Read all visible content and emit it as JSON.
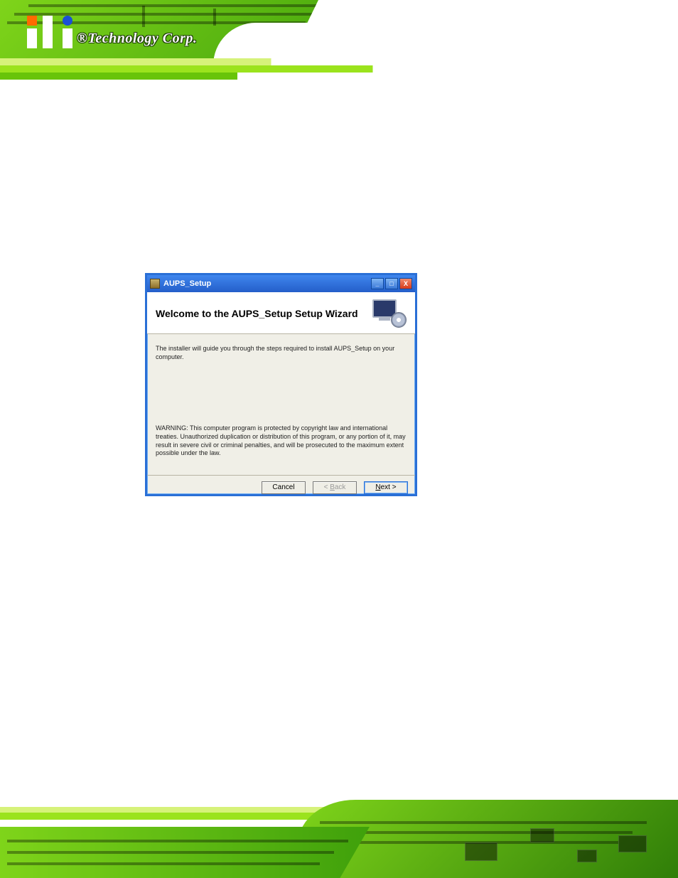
{
  "logo": {
    "brand_text": "®Technology Corp."
  },
  "dialog": {
    "title": "AUPS_Setup",
    "heading": "Welcome to the AUPS_Setup Setup Wizard",
    "intro": "The installer will guide you through the steps required to install AUPS_Setup on your computer.",
    "warning": "WARNING: This computer program is protected by copyright law and international treaties. Unauthorized duplication or distribution of this program, or any portion of it, may result in severe civil or criminal penalties, and will be prosecuted to the maximum extent possible under the law.",
    "buttons": {
      "cancel": "Cancel",
      "back_prefix": "< ",
      "back_u": "B",
      "back_rest": "ack",
      "next_u": "N",
      "next_rest": "ext >"
    },
    "window_controls": {
      "min": "_",
      "max": "□",
      "close": "X"
    }
  }
}
